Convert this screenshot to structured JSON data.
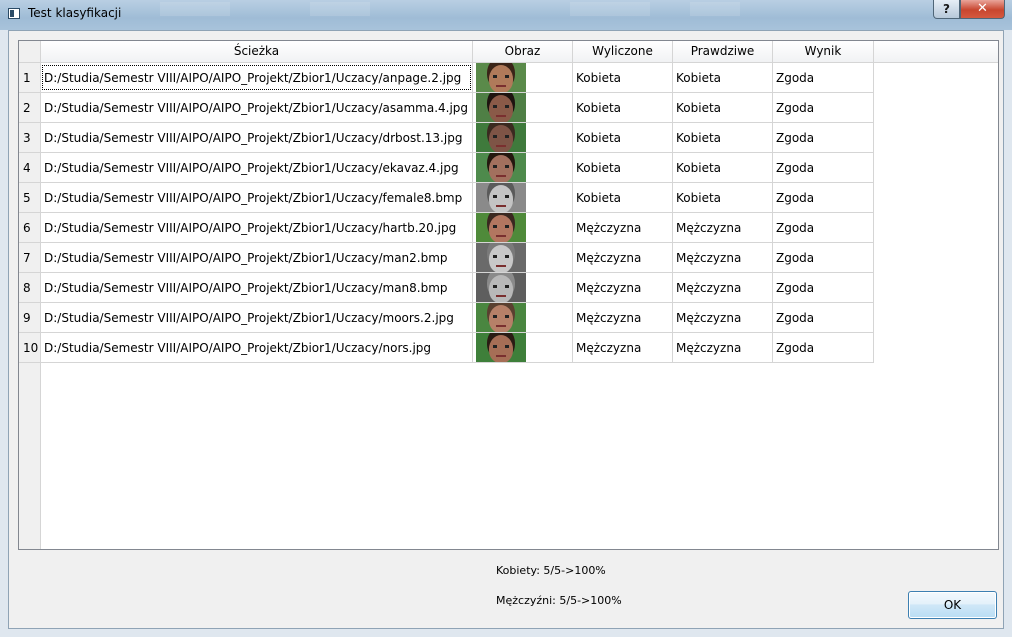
{
  "window": {
    "title": "Test klasyfikacji",
    "help_glyph": "?",
    "close_glyph": "✕"
  },
  "table": {
    "headers": [
      "Ścieżka",
      "Obraz",
      "Wyliczone",
      "Prawdziwe",
      "Wynik"
    ],
    "rows": [
      {
        "num": "1",
        "path": "D:/Studia/Semestr VIII/AIPO/AIPO_Projekt/Zbior1/Uczacy/anpage.2.jpg",
        "calculated": "Kobieta",
        "actual": "Kobieta",
        "result": "Zgoda",
        "image": {
          "bg": "#5a8a4a",
          "skin": "#b07a5a",
          "hair": "#3a2418"
        }
      },
      {
        "num": "2",
        "path": "D:/Studia/Semestr VIII/AIPO/AIPO_Projekt/Zbior1/Uczacy/asamma.4.jpg",
        "calculated": "Kobieta",
        "actual": "Kobieta",
        "result": "Zgoda",
        "image": {
          "bg": "#4f7f45",
          "skin": "#8a5a48",
          "hair": "#1e1410"
        }
      },
      {
        "num": "3",
        "path": "D:/Studia/Semestr VIII/AIPO/AIPO_Projekt/Zbior1/Uczacy/drbost.13.jpg",
        "calculated": "Kobieta",
        "actual": "Kobieta",
        "result": "Zgoda",
        "image": {
          "bg": "#3f7a3c",
          "skin": "#7e5446",
          "hair": "#3a2a20"
        }
      },
      {
        "num": "4",
        "path": "D:/Studia/Semestr VIII/AIPO/AIPO_Projekt/Zbior1/Uczacy/ekavaz.4.jpg",
        "calculated": "Kobieta",
        "actual": "Kobieta",
        "result": "Zgoda",
        "image": {
          "bg": "#4e8a4c",
          "skin": "#a2705e",
          "hair": "#24180f"
        }
      },
      {
        "num": "5",
        "path": "D:/Studia/Semestr VIII/AIPO/AIPO_Projekt/Zbior1/Uczacy/female8.bmp",
        "calculated": "Kobieta",
        "actual": "Kobieta",
        "result": "Zgoda",
        "image": {
          "bg": "#8a8a8a",
          "skin": "#c4c4c4",
          "hair": "#5a5a5a"
        }
      },
      {
        "num": "6",
        "path": "D:/Studia/Semestr VIII/AIPO/AIPO_Projekt/Zbior1/Uczacy/hartb.20.jpg",
        "calculated": "Mężczyzna",
        "actual": "Mężczyzna",
        "result": "Zgoda",
        "image": {
          "bg": "#4f8a3a",
          "skin": "#b27660",
          "hair": "#3a2820"
        }
      },
      {
        "num": "7",
        "path": "D:/Studia/Semestr VIII/AIPO/AIPO_Projekt/Zbior1/Uczacy/man2.bmp",
        "calculated": "Mężczyzna",
        "actual": "Mężczyzna",
        "result": "Zgoda",
        "image": {
          "bg": "#6a6a6a",
          "skin": "#c8c8c8",
          "hair": "#7a7a7a"
        }
      },
      {
        "num": "8",
        "path": "D:/Studia/Semestr VIII/AIPO/AIPO_Projekt/Zbior1/Uczacy/man8.bmp",
        "calculated": "Mężczyzna",
        "actual": "Mężczyzna",
        "result": "Zgoda",
        "image": {
          "bg": "#5e5e5e",
          "skin": "#b8b8b8",
          "hair": "#8a8a8a"
        }
      },
      {
        "num": "9",
        "path": "D:/Studia/Semestr VIII/AIPO/AIPO_Projekt/Zbior1/Uczacy/moors.2.jpg",
        "calculated": "Mężczyzna",
        "actual": "Mężczyzna",
        "result": "Zgoda",
        "image": {
          "bg": "#4a8640",
          "skin": "#b68068",
          "hair": "#5a4030"
        }
      },
      {
        "num": "10",
        "path": "D:/Studia/Semestr VIII/AIPO/AIPO_Projekt/Zbior1/Uczacy/nors.jpg",
        "calculated": "Mężczyzna",
        "actual": "Mężczyzna",
        "result": "Zgoda",
        "image": {
          "bg": "#3e7f3a",
          "skin": "#a66e56",
          "hair": "#2a1c14"
        }
      }
    ]
  },
  "summary": {
    "women": "Kobiety: 5/5->100%",
    "men": "Mężczyźni: 5/5->100%"
  },
  "ok_label": "OK"
}
